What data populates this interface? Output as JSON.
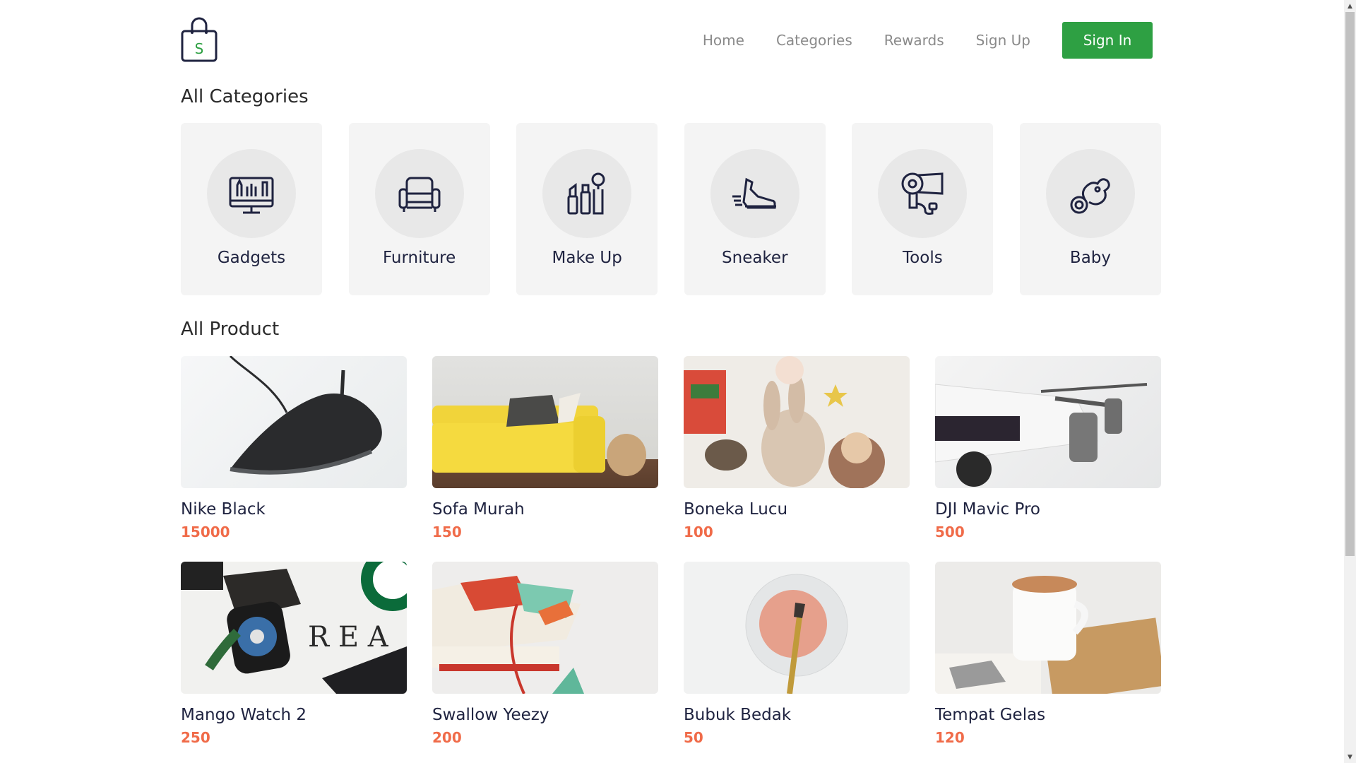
{
  "header": {
    "logo_letter": "S",
    "nav": [
      "Home",
      "Categories",
      "Rewards",
      "Sign Up"
    ],
    "signin_label": "Sign In",
    "accent": "#2ea043"
  },
  "categories": {
    "title": "All Categories",
    "items": [
      {
        "label": "Gadgets",
        "icon": "gadgets-icon"
      },
      {
        "label": "Furniture",
        "icon": "armchair-icon"
      },
      {
        "label": "Make Up",
        "icon": "makeup-icon"
      },
      {
        "label": "Sneaker",
        "icon": "sneaker-icon"
      },
      {
        "label": "Tools",
        "icon": "hair-dryer-icon"
      },
      {
        "label": "Baby",
        "icon": "pacifier-icon"
      }
    ]
  },
  "products": {
    "title": "All Product",
    "price_color": "#f06b49",
    "items": [
      {
        "name": "Nike Black",
        "price": "15000",
        "image": "black-sneaker-photo"
      },
      {
        "name": "Sofa Murah",
        "price": "150",
        "image": "yellow-sofa-photo"
      },
      {
        "name": "Boneka Lucu",
        "price": "100",
        "image": "plush-toys-photo"
      },
      {
        "name": "DJI Mavic Pro",
        "price": "500",
        "image": "drone-photo"
      },
      {
        "name": "Mango Watch 2",
        "price": "250",
        "image": "smartwatch-photo"
      },
      {
        "name": "Swallow Yeezy",
        "price": "200",
        "image": "colorful-sneaker-photo"
      },
      {
        "name": "Bubuk Bedak",
        "price": "50",
        "image": "powder-photo"
      },
      {
        "name": "Tempat Gelas",
        "price": "120",
        "image": "coffee-cup-photo"
      }
    ]
  }
}
